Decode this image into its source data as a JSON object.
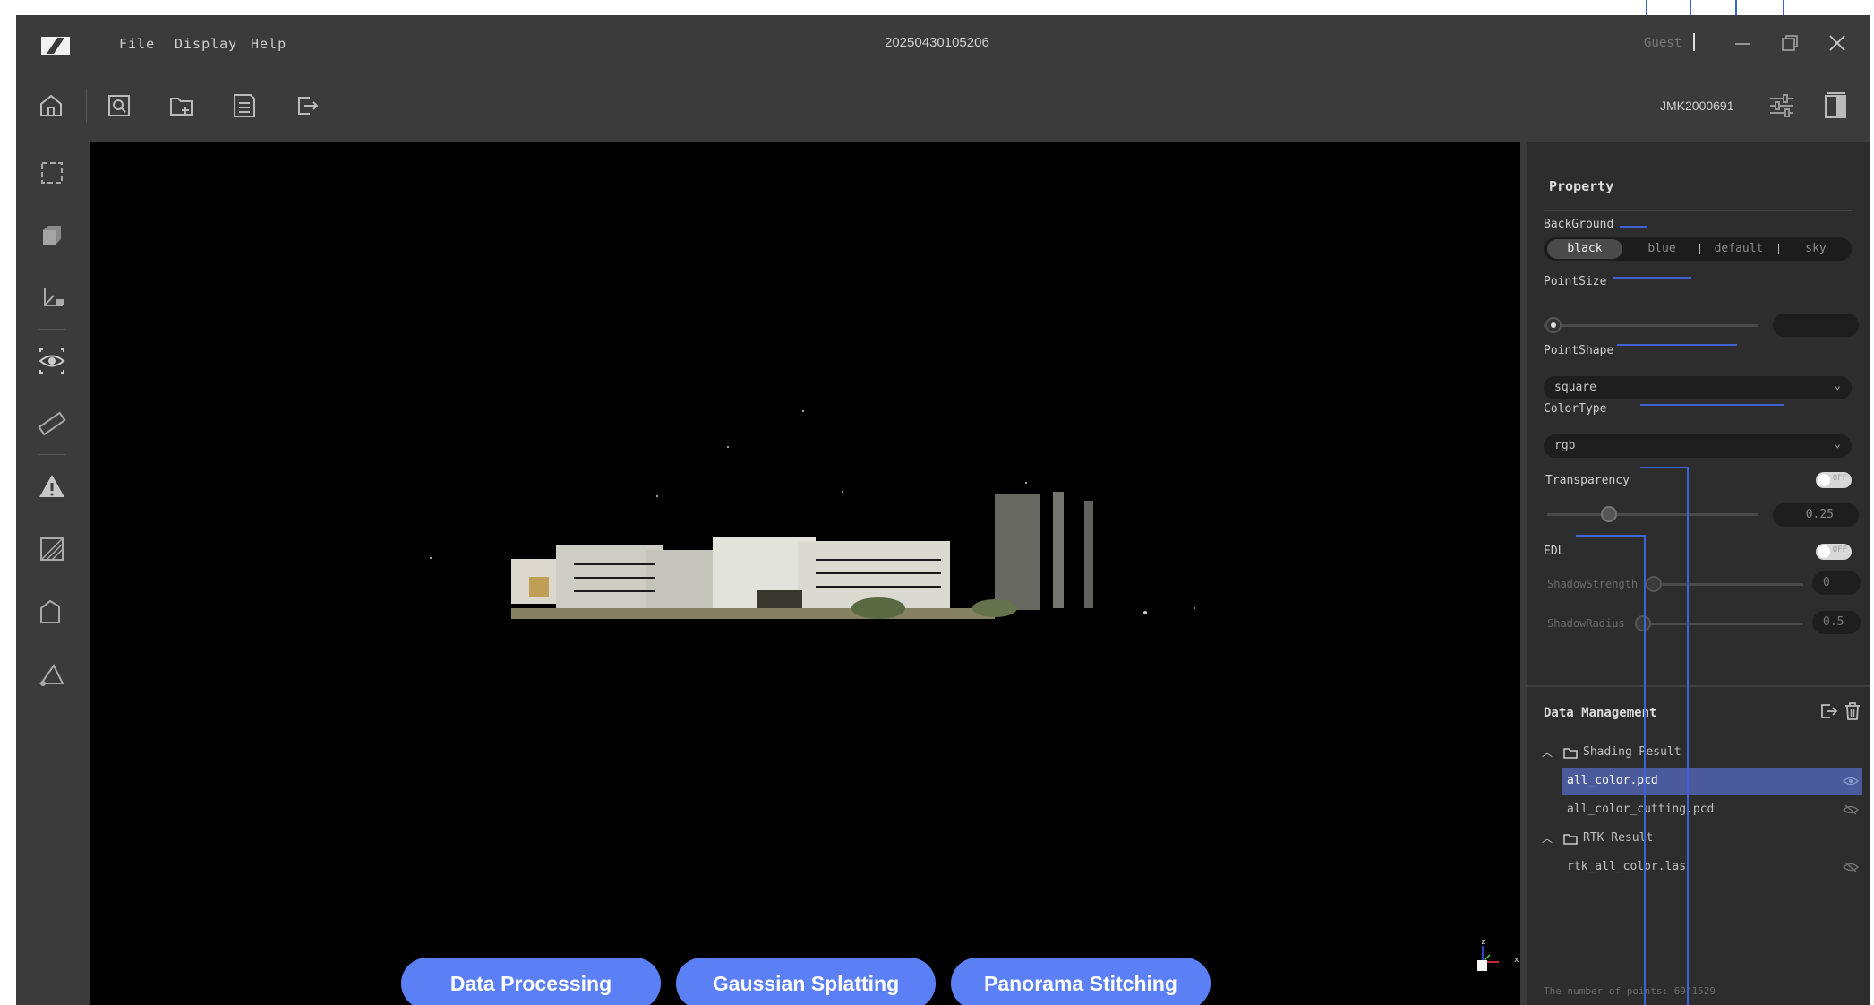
{
  "window": {
    "title": "20250430105206",
    "menu": [
      "File",
      "Display",
      "Help"
    ],
    "user": "Guest",
    "device_serial": "JMK2000691"
  },
  "toolbar": {
    "icons": [
      "home-icon",
      "open-file-icon",
      "open-folder-icon",
      "save-icon",
      "export-icon"
    ],
    "right_icons": [
      "sliders-icon",
      "panel-toggle-icon"
    ]
  },
  "left_tools": [
    "fit-view-icon",
    "cube-view-icon",
    "axis-icon",
    "eye-icon",
    "ruler-icon",
    "triangle-icon",
    "crop-icon",
    "polygon-icon",
    "angle-icon"
  ],
  "property": {
    "title": "Property",
    "background": {
      "label": "BackGround",
      "options": [
        "black",
        "blue",
        "default",
        "sky"
      ],
      "selected": "black"
    },
    "point_size": {
      "label": "PointSize"
    },
    "point_shape": {
      "label": "PointShape",
      "value": "square"
    },
    "color_type": {
      "label": "ColorType",
      "value": "rgb"
    },
    "transparency": {
      "label": "Transparency",
      "toggle": "OFF",
      "value": "0.25"
    },
    "edl": {
      "label": "EDL",
      "toggle": "OFF",
      "shadow_strength": {
        "label": "ShadowStrength",
        "value": "0"
      },
      "shadow_radius": {
        "label": "ShadowRadius",
        "value": "0.5"
      }
    }
  },
  "data_management": {
    "title": "Data Management",
    "groups": [
      {
        "name": "Shading Result",
        "files": [
          "all_color.pcd",
          "all_color_cutting.pcd"
        ]
      },
      {
        "name": "RTK Result",
        "files": [
          "rtk_all_color.las"
        ]
      }
    ],
    "selected_file": "all_color.pcd",
    "footer": "The number of points: 6941529"
  },
  "axis_gizmo": {
    "z": "z",
    "x": "x"
  },
  "actions": [
    "Data Processing",
    "Gaussian Splatting",
    "Panorama Stitching"
  ],
  "colors": {
    "accent": "#5b80f5",
    "annotation_line": "#3f62d6",
    "selection": "#4a5a9a"
  }
}
